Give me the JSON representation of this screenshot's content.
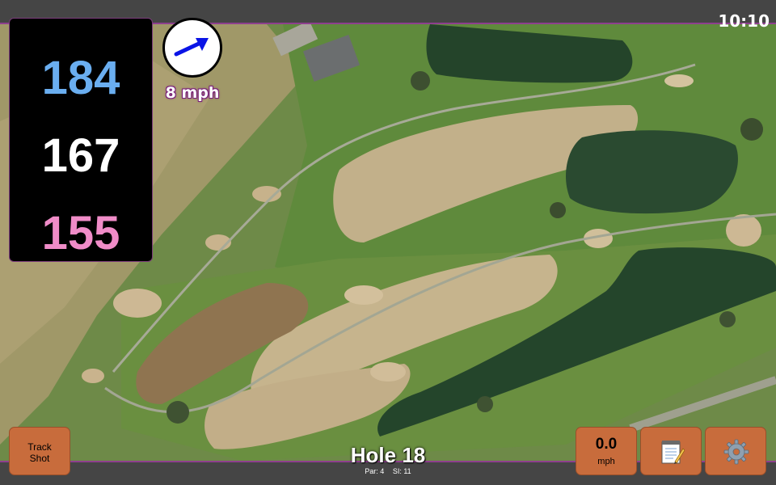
{
  "status": {
    "time": "10:10"
  },
  "distances": {
    "back": {
      "value": "184",
      "color": "#6aaef0"
    },
    "middle": {
      "value": "167",
      "color": "#ffffff"
    },
    "front": {
      "value": "155",
      "color": "#f08cc8"
    }
  },
  "wind": {
    "speed": "8 mph",
    "arrow_color": "#0a14e6",
    "icon": "wind-arrow-icon"
  },
  "buttons": {
    "track_shot": [
      "Track",
      "Shot"
    ],
    "speed": {
      "value": "0.0",
      "unit": "mph"
    },
    "notes_icon": "notepad-icon",
    "settings_icon": "gear-icon",
    "accent": "#c86c3c"
  },
  "hole": {
    "title": "Hole 18",
    "par_label": "Par: 4",
    "si_label": "SI: 11"
  }
}
